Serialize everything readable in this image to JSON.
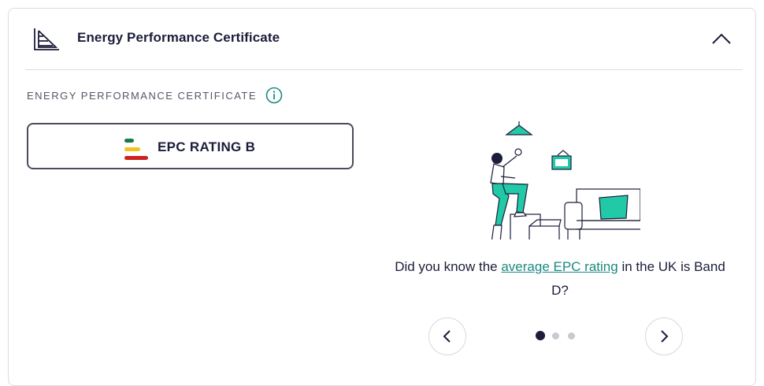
{
  "header": {
    "title": "Energy Performance Certificate",
    "icon": "energy-chart-icon",
    "collapse_icon": "chevron-up-icon"
  },
  "section": {
    "label": "ENERGY PERFORMANCE CERTIFICATE",
    "info_icon": "info-icon"
  },
  "epc": {
    "label": "EPC RATING B",
    "bar_colors": [
      "#1a7a4a",
      "#f3c21c",
      "#d02020"
    ]
  },
  "carousel": {
    "fact_before": "Did you know the ",
    "fact_link": "average EPC rating",
    "fact_after": " in the UK is Band D?",
    "slide_count": 3,
    "active_slide": 1,
    "accent_color": "#22c9a6"
  }
}
